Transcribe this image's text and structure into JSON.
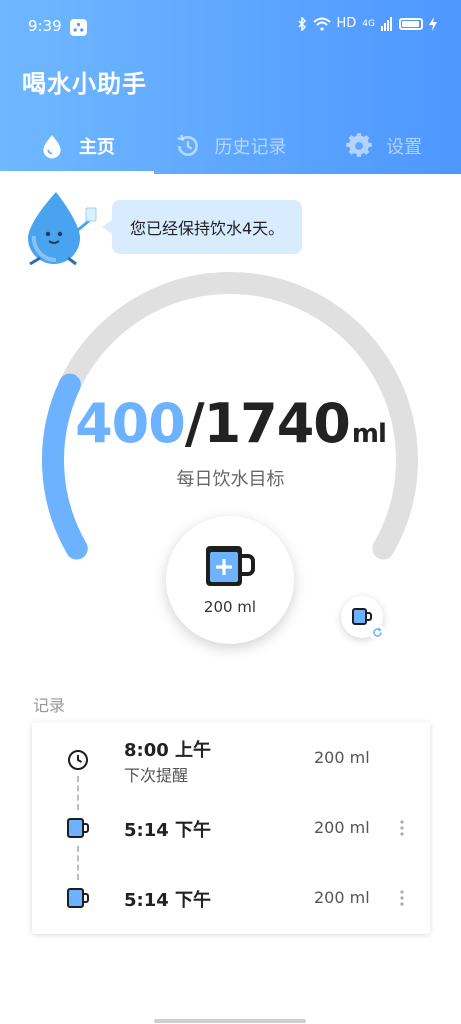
{
  "status_bar": {
    "time": "9:39",
    "network_label": "HD",
    "signal_label": "4G"
  },
  "app": {
    "title": "喝水小助手"
  },
  "tabs": [
    {
      "label": "主页",
      "icon": "water-drop-icon",
      "active": true
    },
    {
      "label": "历史记录",
      "icon": "history-icon",
      "active": false
    },
    {
      "label": "设置",
      "icon": "gear-icon",
      "active": false
    }
  ],
  "encouragement": {
    "text": "您已经保持饮水4天。",
    "mascot_icon": "water-drop-mascot-icon"
  },
  "intake": {
    "current": "400",
    "separator": "/",
    "goal": "1740",
    "unit": "ml",
    "goal_label": "每日饮水目标",
    "progress_fraction": 0.23
  },
  "add_cup": {
    "amount_label": "200 ml",
    "icon": "cup-plus-icon"
  },
  "switch_cup": {
    "icon": "cup-switch-icon"
  },
  "records": {
    "title": "记录",
    "items": [
      {
        "type": "reminder",
        "time": "8:00 上午",
        "sub": "下次提醒",
        "amount": "200 ml",
        "icon": "clock-icon"
      },
      {
        "type": "drink",
        "time": "5:14 下午",
        "amount": "200 ml",
        "icon": "cup-icon"
      },
      {
        "type": "drink",
        "time": "5:14 下午",
        "amount": "200 ml",
        "icon": "cup-icon"
      }
    ]
  },
  "colors": {
    "accent": "#6cb2ff",
    "header_start": "#6fb8ff",
    "header_end": "#4e97ff",
    "track": "#e0e0e0",
    "bubble": "#d8ebff"
  }
}
